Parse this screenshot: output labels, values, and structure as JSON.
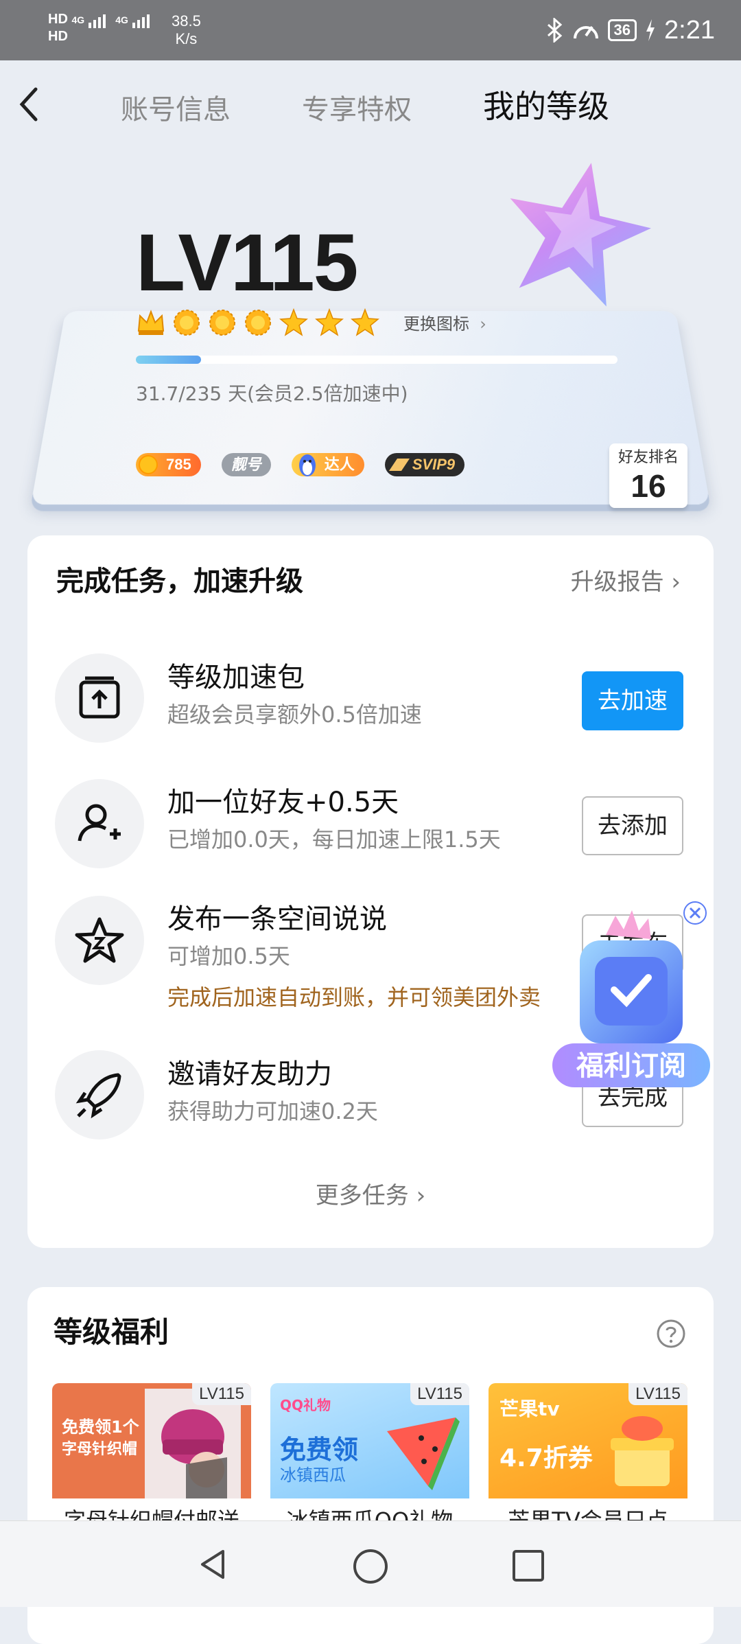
{
  "status_bar": {
    "hd1": "HD",
    "hd2": "HD",
    "net1": "4G",
    "net2": "4G",
    "speed_value": "38.5",
    "speed_unit": "K/s",
    "battery": "36",
    "time": "2:21"
  },
  "nav": {
    "tabs": [
      "账号信息",
      "专享特权",
      "我的等级"
    ],
    "active_tab": "我的等级"
  },
  "level_card": {
    "level": "LV115",
    "medals": [
      "crown",
      "sun",
      "sun",
      "sun",
      "star",
      "star",
      "star"
    ],
    "change_icon_label": "更换图标",
    "progress": 0.135,
    "progress_text": "31.7/235 天(会员2.5倍加速中)",
    "badges": {
      "coin_value": "785",
      "nice_id": "靓号",
      "talent": "达人",
      "svip": "SVIP9"
    },
    "friend_rank_label": "好友排名",
    "friend_rank": "16"
  },
  "tasks": {
    "title": "完成任务，加速升级",
    "report_link": "升级报告",
    "items": [
      {
        "title": "等级加速包",
        "subtitle": "超级会员享额外0.5倍加速",
        "button": "去加速"
      },
      {
        "title": "加一位好友+0.5天",
        "subtitle": "已增加0.0天，每日加速上限1.5天",
        "button": "去添加"
      },
      {
        "title": "发布一条空间说说",
        "subtitle": "可增加0.5天",
        "note": "完成后加速自动到账，并可领美团外卖",
        "button": "去发布"
      },
      {
        "title": "邀请好友助力",
        "subtitle": "获得助力可加速0.2天",
        "button": "去完成"
      }
    ],
    "more": "更多任务"
  },
  "promo": {
    "label": "福利订阅"
  },
  "benefits": {
    "title": "等级福利",
    "cards": [
      {
        "tag": "LV115",
        "image_text_1": "免费领1个",
        "image_text_2": "字母针织帽",
        "caption": "字母针织帽付邮送"
      },
      {
        "tag": "LV115",
        "image_brand": "QQ礼物",
        "image_text_1": "免费领",
        "image_text_2": "冰镇西瓜",
        "caption": "冰镇西瓜QQ礼物"
      },
      {
        "tag": "LV115",
        "image_brand": "芒果tv",
        "image_text_1": "4.7折券",
        "caption": "芒果TV会员只点"
      }
    ]
  },
  "colors": {
    "accent": "#1296f6",
    "note": "#a0641e",
    "status_bar": "#77787b",
    "page_bg": "#e9edf3"
  }
}
